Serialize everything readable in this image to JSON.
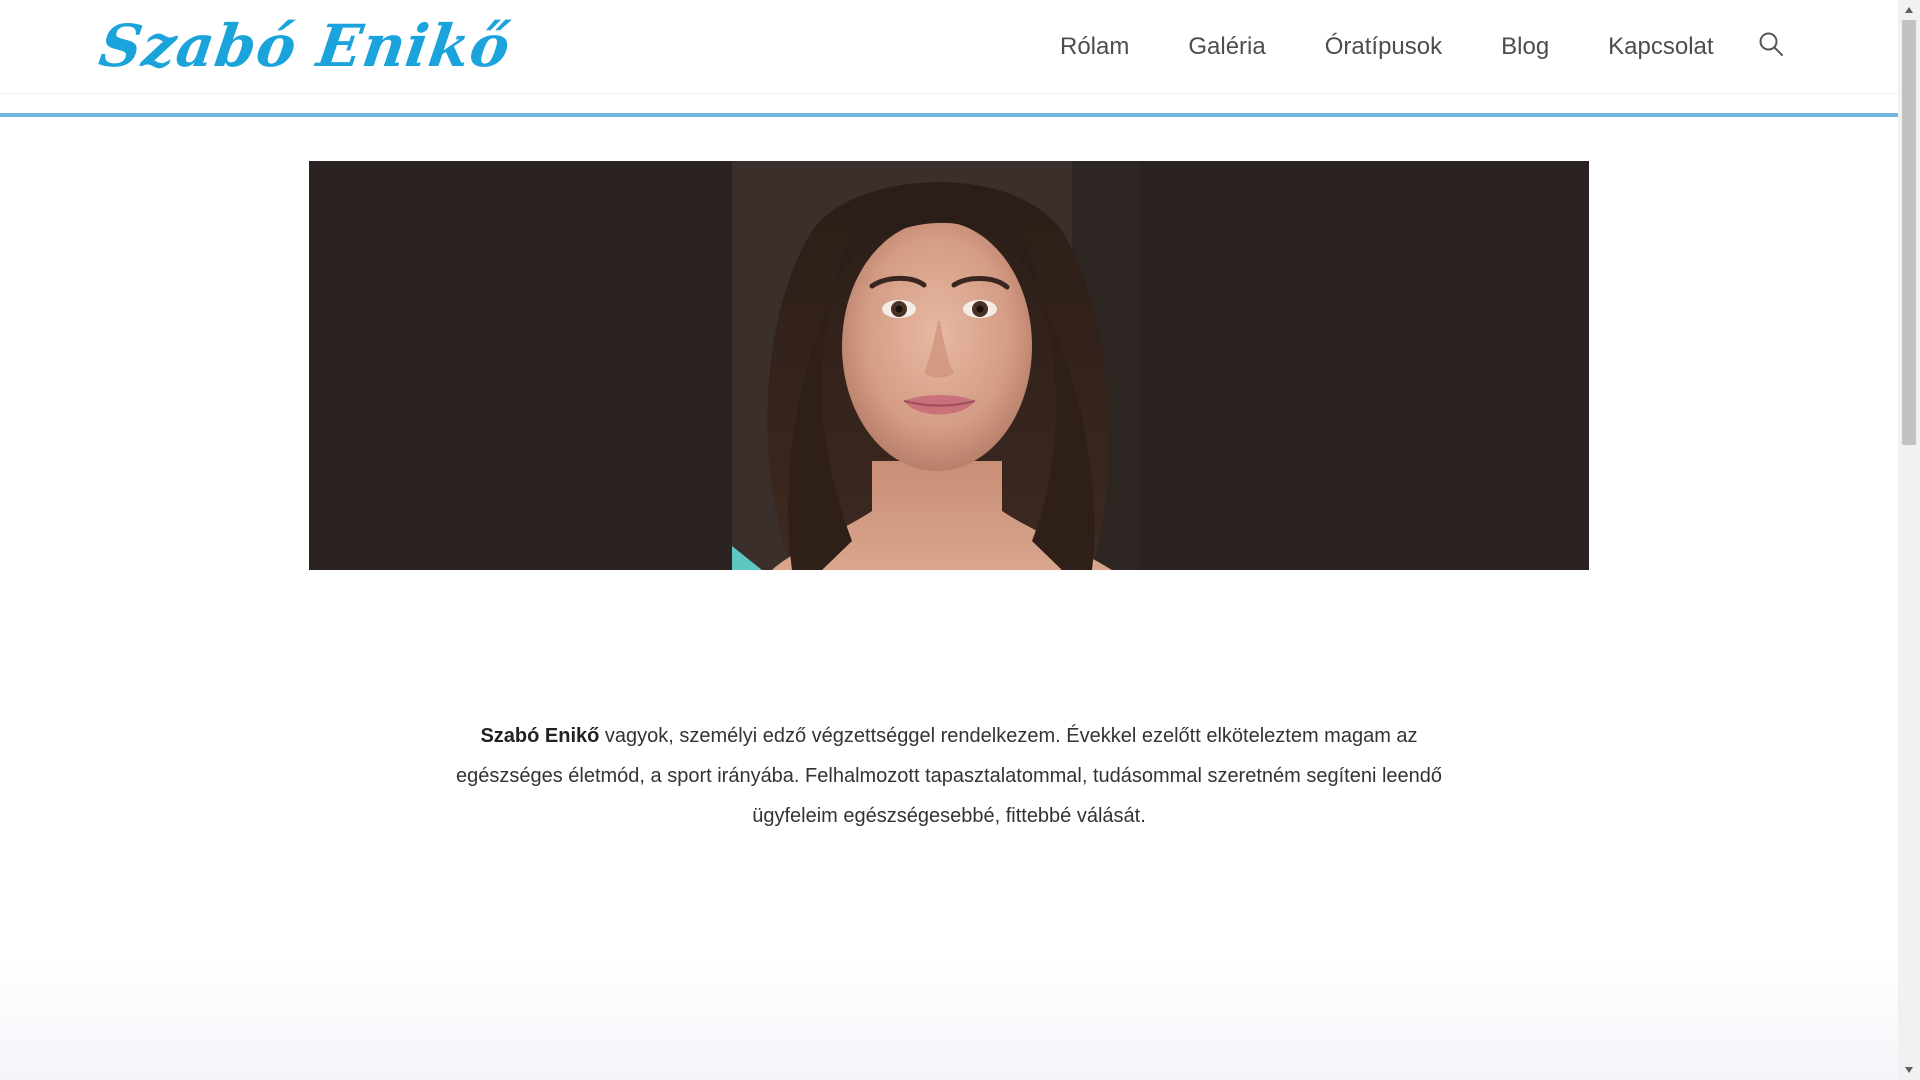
{
  "site": {
    "logo_text": "Szabó Enikő"
  },
  "nav": {
    "items": [
      {
        "label": "Rólam"
      },
      {
        "label": "Galéria"
      },
      {
        "label": "Óratípusok"
      },
      {
        "label": "Blog"
      },
      {
        "label": "Kapcsolat"
      }
    ],
    "search_icon": "search-icon"
  },
  "colors": {
    "logo": "#1ba3db",
    "accent_line": "#6db6dc",
    "hero_background": "#2a2321"
  },
  "intro": {
    "name": "Szabó Enikő",
    "text": " vagyok, személyi edző végzettséggel rendelkezem. Évekkel ezelőtt elköteleztem magam az egészséges életmód, a sport irányába. Felhalmozott tapasztalatommal, tudásommal szeretném segíteni leendő ügyfeleim egészségesebbé, fittebbé válását."
  }
}
